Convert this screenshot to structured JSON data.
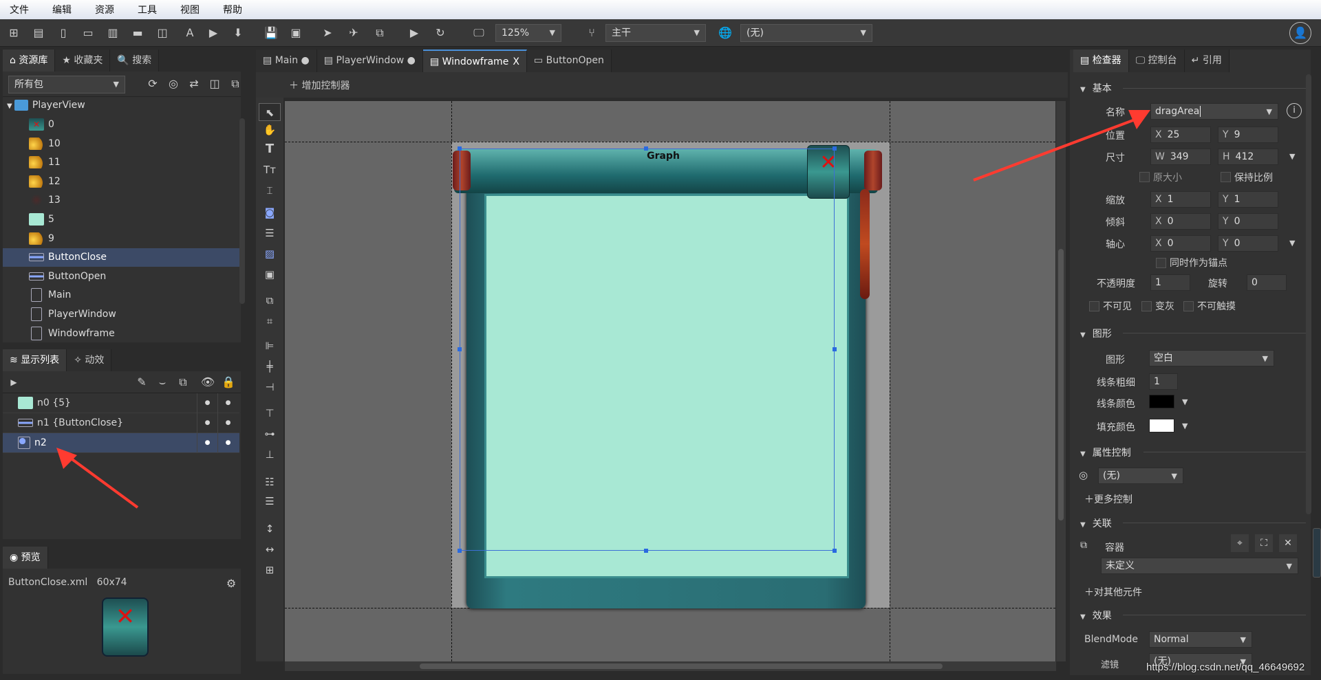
{
  "menu": [
    "文件",
    "编辑",
    "资源",
    "工具",
    "视图",
    "帮助"
  ],
  "toolbar": {
    "zoom": "125%",
    "branch": "主干",
    "language": "(无)"
  },
  "left": {
    "tabs": [
      "资源库",
      "收藏夹",
      "搜索"
    ],
    "package_filter": "所有包",
    "tree_root": "PlayerView",
    "tree": [
      {
        "label": "0",
        "icon": "close-button-thumb"
      },
      {
        "label": "10",
        "icon": "gold-image-thumb"
      },
      {
        "label": "11",
        "icon": "gold-image-thumb"
      },
      {
        "label": "12",
        "icon": "gold-image-thumb"
      },
      {
        "label": "13",
        "icon": "dark-image-thumb"
      },
      {
        "label": "5",
        "icon": "mint-rect-thumb"
      },
      {
        "label": "9",
        "icon": "gold-image-thumb"
      },
      {
        "label": "ButtonClose",
        "icon": "button-component-icon",
        "selected": true
      },
      {
        "label": "ButtonOpen",
        "icon": "button-component-icon"
      },
      {
        "label": "Main",
        "icon": "document-icon"
      },
      {
        "label": "PlayerWindow",
        "icon": "document-icon"
      },
      {
        "label": "Windowframe",
        "icon": "document-icon"
      }
    ],
    "display_tabs": [
      "显示列表",
      "动效"
    ],
    "display_list": [
      {
        "label": "n0 {5}",
        "icon": "mint-rect-thumb"
      },
      {
        "label": "n1 {ButtonClose}",
        "icon": "button-component-icon"
      },
      {
        "label": "n2",
        "icon": "graph-icon",
        "selected": true
      }
    ],
    "preview_tab": "预览",
    "preview_file": "ButtonClose.xml",
    "preview_size": "60x74"
  },
  "center": {
    "tabs": [
      {
        "label": "Main",
        "modified": true
      },
      {
        "label": "PlayerWindow",
        "modified": true
      },
      {
        "label": "Windowframe",
        "active": true,
        "close": "X"
      },
      {
        "label": "ButtonOpen"
      }
    ],
    "add_controller": "增加控制器",
    "graph_label": "Graph"
  },
  "inspector": {
    "tabs": [
      "检查器",
      "控制台",
      "引用"
    ],
    "basic": "基本",
    "name_label": "名称",
    "name_value": "dragArea",
    "pos_label": "位置",
    "x": "25",
    "y": "9",
    "size_label": "尺寸",
    "w": "349",
    "h": "412",
    "orig_size": "原大小",
    "keep_ratio": "保持比例",
    "scale_label": "缩放",
    "scale_x": "1",
    "scale_y": "1",
    "skew_label": "倾斜",
    "skew_x": "0",
    "skew_y": "0",
    "pivot_label": "轴心",
    "pivot_x": "0",
    "pivot_y": "0",
    "as_anchor": "同时作为锚点",
    "alpha_label": "不透明度",
    "alpha": "1",
    "rotation_label": "旋转",
    "rotation": "0",
    "invisible": "不可见",
    "grayed": "变灰",
    "untouchable": "不可触摸",
    "shape_section": "图形",
    "shape_label": "图形",
    "shape_value": "空白",
    "line_size_label": "线条粗细",
    "line_size": "1",
    "line_color_label": "线条颜色",
    "line_color": "#000000",
    "fill_color_label": "填充颜色",
    "fill_color": "#ffffff",
    "gear_section": "属性控制",
    "gear_value": "(无)",
    "more_gears": "更多控制",
    "relation_section": "关联",
    "container": "容器",
    "container_value": "未定义",
    "other": "对其他元件",
    "effect_section": "效果",
    "blend_label": "BlendMode",
    "blend_value": "Normal",
    "filter_label": "滤镜",
    "filter_value": "(无)",
    "letters": {
      "x": "X",
      "y": "Y",
      "w": "W",
      "h": "H"
    }
  },
  "colors": {
    "selection": "#3c4a66",
    "mint": "#a8e8d4",
    "accent": "#4a90d9"
  },
  "watermark": "https://blog.csdn.net/qq_46649692"
}
